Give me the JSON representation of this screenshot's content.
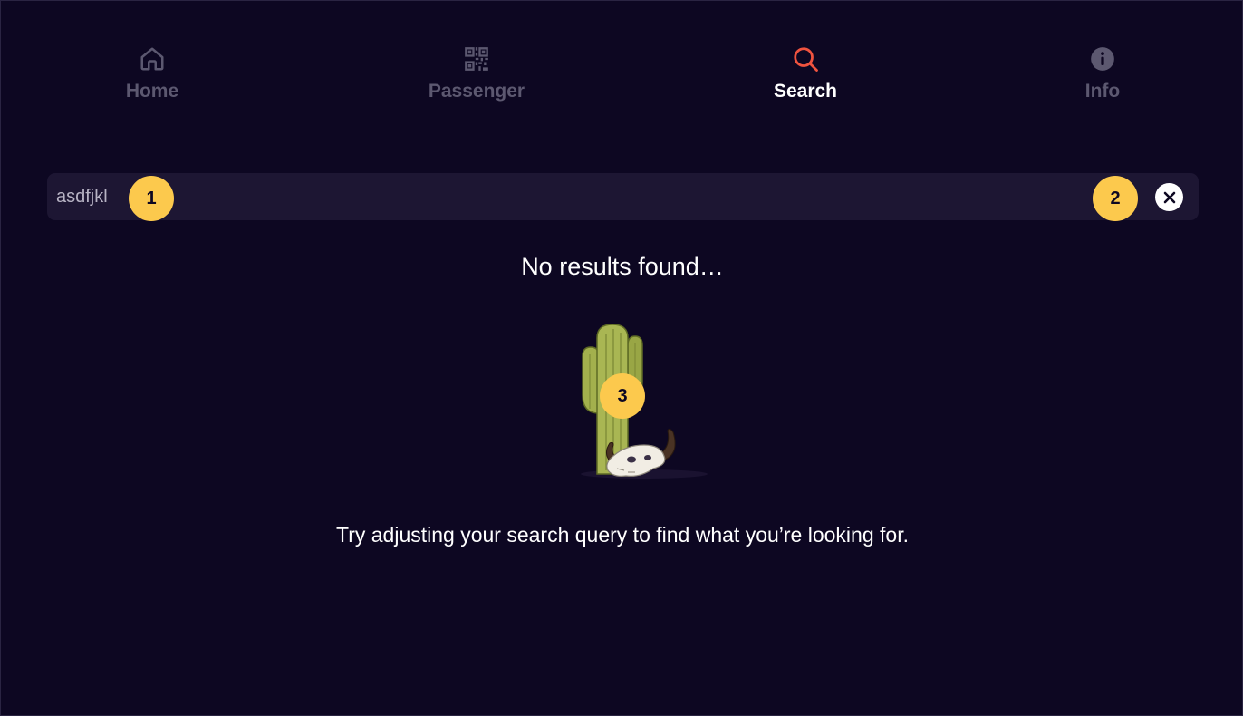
{
  "nav": {
    "tabs": [
      {
        "label": "Home",
        "icon": "home-icon",
        "active": false
      },
      {
        "label": "Passenger",
        "icon": "qr-code-icon",
        "active": false
      },
      {
        "label": "Search",
        "icon": "search-icon",
        "active": true
      },
      {
        "label": "Info",
        "icon": "info-icon",
        "active": false
      }
    ]
  },
  "search": {
    "value": "asdfjkl",
    "clear_icon": "close-circle-icon"
  },
  "empty_state": {
    "title": "No results found…",
    "illustration": "cactus-skull-illustration",
    "subtitle": "Try adjusting your search query to find what you’re looking for."
  },
  "annotations": {
    "markers": [
      "1",
      "2",
      "3"
    ]
  },
  "colors": {
    "background": "#0d0722",
    "search_bar": "#1d1633",
    "active_icon": "#f0533f",
    "inactive": "#5c5870",
    "marker": "#fcc94d"
  }
}
